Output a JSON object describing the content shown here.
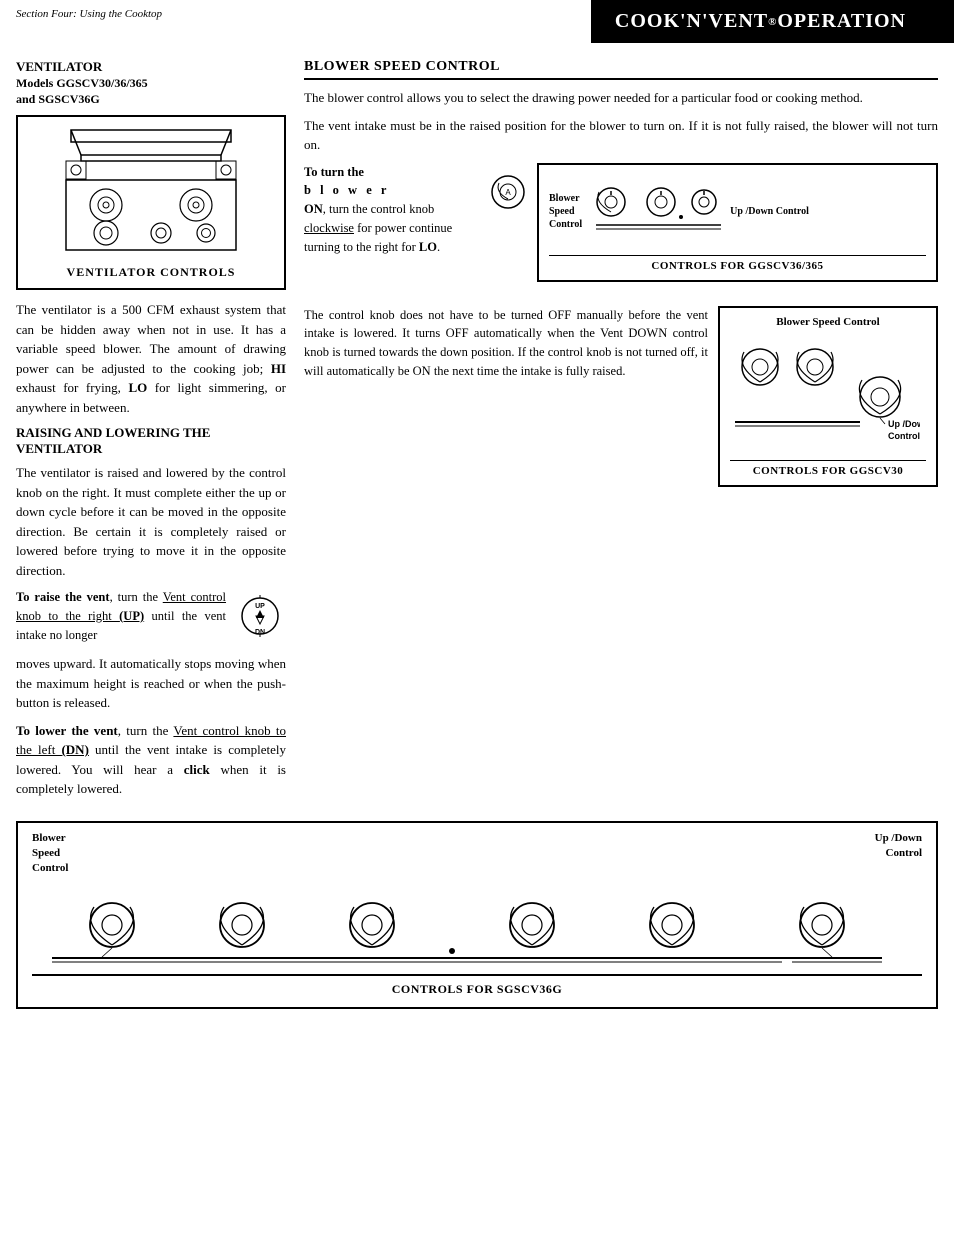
{
  "header": {
    "section_label": "Section Four: Using the Cooktop",
    "title": "COOK'N'VENT",
    "trademark": "®",
    "subtitle": " OPERATION"
  },
  "left": {
    "ventilator_title": "VENTILATOR",
    "ventilator_models": "Models  GGSCV30/36/365",
    "ventilator_models2": "and SGSCV36G",
    "ventilator_controls_label": "VENTILATOR CONTROLS",
    "ventilator_desc": "The ventilator is a 500 CFM exhaust system that can be hidden away when not in use. It has a variable speed blower. The amount of drawing power can be adjusted to the cooking job; HI exhaust for frying, LO for light simmering, or anywhere in between.",
    "raising_title": "RAISING AND LOWERING THE VENTILATOR",
    "raising_desc": "The ventilator is raised and lowered by the control knob on the right. It must complete either the up or down cycle before it can be moved in the opposite direction. Be certain it is completely raised or lowered before trying to move it in the opposite direction.",
    "raise_vent_bold": "To raise the vent",
    "raise_vent_text": ", turn the Vent control knob to the right (UP) until the vent intake no longer moves upward. It automatically stops moving when the maximum height is reached or when the push-button is released.",
    "lower_vent_bold": "To lower the vent",
    "lower_vent_text": ", turn the Vent control knob to the left (DN) until the vent intake is completely lowered. You will hear a click when it is completely lowered.",
    "up_text": "UP",
    "dn_text": "DN",
    "up_underline": "Vent control knob to the right",
    "dn_underline": "Vent control knob to the left (DN)"
  },
  "right": {
    "blower_heading": "BLOWER SPEED CONTROL",
    "blower_desc1": "The blower control allows you to select the drawing power needed for a particular food or cooking method.",
    "blower_desc2": "The vent intake must be in the raised position for the blower to turn on. If it is not fully raised, the blower will not turn on.",
    "turn_on_prefix": "To turn the",
    "turn_on_blower": "b l o w e r",
    "turn_on_on": "ON",
    "turn_on_rest": ", turn the control knob ",
    "turn_on_clockwise": "clockwise",
    "turn_on_end": " for power continue turning to the right for ",
    "turn_on_lo": "LO",
    "turn_on_period": ".",
    "blower_label": "Blower\nSpeed\nControl",
    "updown_label": "Up /Down Control",
    "diagram36_title": "CONTROLS FOR GGSCV36/365",
    "blower_desc3": "The control knob does not have to be turned OFF manually before the vent intake is lowered. It turns OFF automatically when the Vent DOWN control knob is turned towards the down position. If the control knob is not turned off, it will automatically be ON the next time  the intake is fully raised.",
    "diagram30_heading": "Blower Speed Control",
    "diagram30_updown": "Up /Down\nControl",
    "diagram30_title": "CONTROLS FOR GGSCV30",
    "sgscv_blower": "Blower\nSpeed\nControl",
    "sgscv_updown": "Up /Down\nControl",
    "sgscv_title": "CONTROLS FOR SGSCV36G"
  }
}
